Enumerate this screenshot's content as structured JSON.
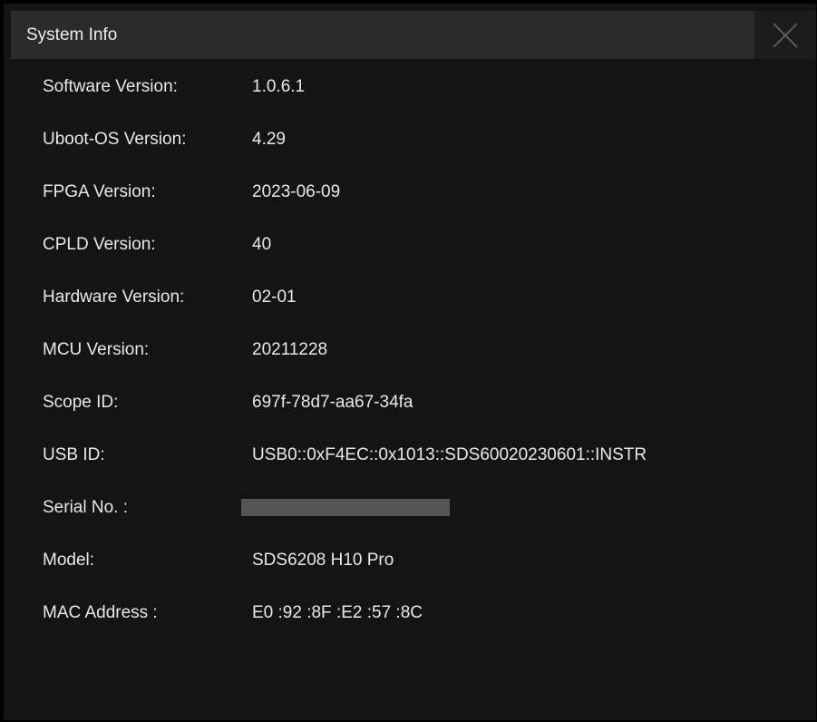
{
  "dialog": {
    "title": "System Info",
    "close_icon": "close-icon"
  },
  "rows": [
    {
      "label": "Software Version:",
      "value": "1.0.6.1"
    },
    {
      "label": "Uboot-OS Version:",
      "value": "4.29"
    },
    {
      "label": "FPGA Version:",
      "value": "2023-06-09"
    },
    {
      "label": "CPLD Version:",
      "value": "40"
    },
    {
      "label": "Hardware Version:",
      "value": "02-01"
    },
    {
      "label": "MCU Version:",
      "value": "20211228"
    },
    {
      "label": "Scope ID:",
      "value": "697f-78d7-aa67-34fa"
    },
    {
      "label": "USB ID:",
      "value": "USB0::0xF4EC::0x1013::SDS60020230601::INSTR"
    },
    {
      "label": "Serial No. :",
      "value": ""
    },
    {
      "label": "Model:",
      "value": "SDS6208 H10 Pro"
    },
    {
      "label": "MAC Address :",
      "value": "E0 :92 :8F :E2 :57 :8C"
    }
  ],
  "colors": {
    "background": "#141414",
    "titlebar": "#2b2b2b",
    "text": "#e8e8e8",
    "redaction": "#555555"
  }
}
